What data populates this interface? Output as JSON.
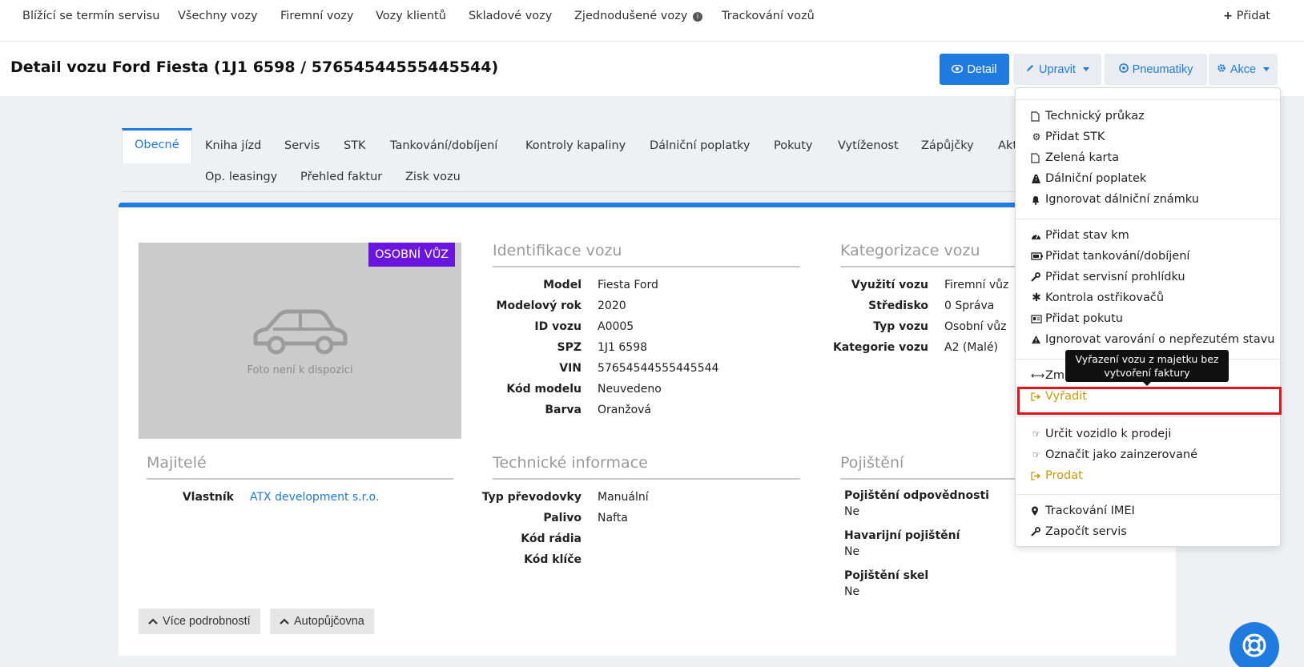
{
  "topnav": {
    "items": [
      "Blížící se termín servisu",
      "Všechny vozy",
      "Firemní vozy",
      "Vozy klientů",
      "Skladové vozy",
      "Zjednodušené vozy",
      "Trackování vozů"
    ],
    "add_label": "Přidat"
  },
  "header": {
    "title": "Detail vozu Ford Fiesta (1J1 6598 / 57654544555445544)",
    "buttons": {
      "detail": "Detail",
      "edit": "Upravit",
      "tires": "Pneumatiky",
      "actions": "Akce"
    }
  },
  "tabs": {
    "row1": [
      "Obecné",
      "Kniha jízd",
      "Servis",
      "STK",
      "Tankování/dobíjení",
      "Kontroly kapaliny",
      "Dálniční poplatky",
      "Pokuty",
      "Vytíženost",
      "Zápůjčky",
      "Akt"
    ],
    "row2": [
      "Op. leasingy",
      "Přehled faktur",
      "Zisk vozu"
    ],
    "active": "Obecné"
  },
  "photo": {
    "badge": "OSOBNÍ VŮZ",
    "placeholder": "Foto není k dispozici"
  },
  "identification": {
    "title": "Identifikace vozu",
    "rows": [
      {
        "label": "Model",
        "value": "Fiesta Ford"
      },
      {
        "label": "Modelový rok",
        "value": "2020"
      },
      {
        "label": "ID vozu",
        "value": "A0005"
      },
      {
        "label": "SPZ",
        "value": "1J1 6598"
      },
      {
        "label": "VIN",
        "value": "57654544555445544"
      },
      {
        "label": "Kód modelu",
        "value": "Neuvedeno"
      },
      {
        "label": "Barva",
        "value": "Oranžová"
      }
    ]
  },
  "categorization": {
    "title": "Kategorizace vozu",
    "rows": [
      {
        "label": "Využití vozu",
        "value": "Firemní vůz"
      },
      {
        "label": "Středisko",
        "value": "0 Správa"
      },
      {
        "label": "Typ vozu",
        "value": "Osobní vůz"
      },
      {
        "label": "Kategorie vozu",
        "value": "A2 (Malé)"
      }
    ]
  },
  "owners": {
    "title": "Majitelé",
    "rows": [
      {
        "label": "Vlastník",
        "value": "ATX development s.r.o."
      }
    ]
  },
  "technical": {
    "title": "Technické informace",
    "rows": [
      {
        "label": "Typ převodovky",
        "value": "Manuální"
      },
      {
        "label": "Palivo",
        "value": "Nafta"
      },
      {
        "label": "Kód rádia",
        "value": ""
      },
      {
        "label": "Kód klíče",
        "value": ""
      }
    ]
  },
  "insurance": {
    "title": "Pojištění",
    "rows": [
      {
        "label": "Pojištění odpovědnosti",
        "value": "Ne"
      },
      {
        "label": "Havarijní pojištění",
        "value": "Ne"
      },
      {
        "label": "Pojištění skel",
        "value": "Ne"
      }
    ]
  },
  "bottom_buttons": {
    "more_details": "Více podrobností",
    "rental": "Autopůjčovna"
  },
  "actions_menu": {
    "group1": [
      "Technický průkaz",
      "Přidat STK",
      "Zelená karta",
      "Dálniční poplatek",
      "Ignorovat dálniční známku"
    ],
    "group2": [
      "Přidat stav km",
      "Přidat tankování/dobíjení",
      "Přidat servisní prohlídku",
      "Kontrola ostřikovačů",
      "Přidat pokutu",
      "Ignorovat varování o nepřezutém stavu"
    ],
    "group3": [
      "Změna stř",
      "Vyřadit"
    ],
    "group4": [
      "Určit vozidlo k prodeji",
      "Označit jako zainzerované",
      "Prodat"
    ],
    "group5": [
      "Trackování IMEI",
      "Započít servis"
    ]
  },
  "tooltip": {
    "text": "Vyřazení vozu z majetku bez vytvoření faktury"
  },
  "colors": {
    "primary": "#1f7be0",
    "badge": "#6b16df",
    "gold": "#c89a06",
    "highlight": "#e3141c"
  }
}
